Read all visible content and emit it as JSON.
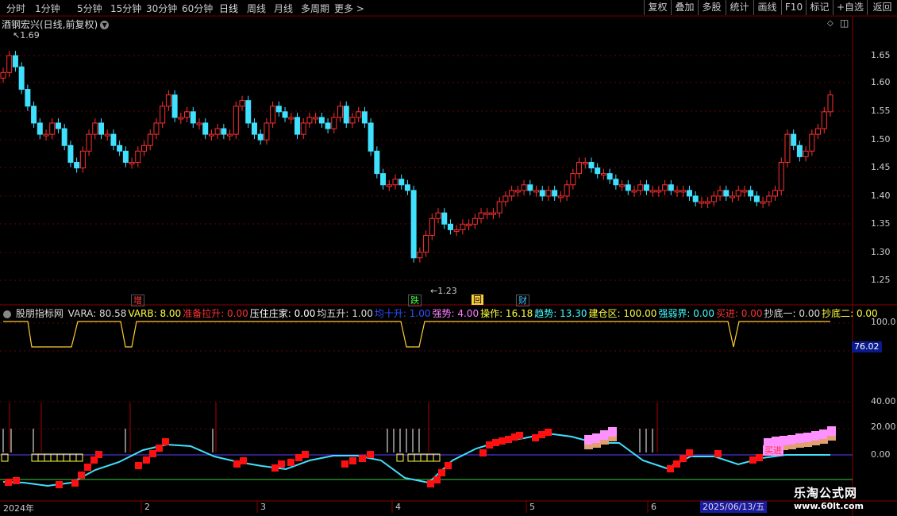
{
  "toolbar": {
    "periods": [
      "分时",
      "1分钟",
      "5分钟",
      "15分钟",
      "30分钟",
      "60分钟",
      "日线",
      "周线",
      "月线",
      "多周期",
      "更多 >"
    ],
    "active_period": "日线",
    "right_buttons": [
      "复权",
      "叠加",
      "多股",
      "统计",
      "画线",
      "F10",
      "标记",
      "+自选",
      "返回"
    ]
  },
  "stock": {
    "title": "酒钢宏兴(日线,前复权)",
    "high_label": "1.69",
    "low_label": "1.23"
  },
  "price_axis": [
    "1.65",
    "1.60",
    "1.55",
    "1.50",
    "1.45",
    "1.40",
    "1.35",
    "1.30",
    "1.25"
  ],
  "markers": [
    {
      "text": "增",
      "color": "#ff4040"
    },
    {
      "text": "跌",
      "color": "#40ff40"
    },
    {
      "text": "回",
      "color": "#ffd040"
    },
    {
      "text": "财",
      "color": "#40c0ff"
    }
  ],
  "indicator": {
    "name": "股朋指标网",
    "items": [
      {
        "label": "VARA: 80.58",
        "color": "#dddddd"
      },
      {
        "label": "VARB: 8.00",
        "color": "#ffff40"
      },
      {
        "label": "准备拉升: 0.00",
        "color": "#ff3030"
      },
      {
        "label": "压住庄家: 0.00",
        "color": "#ffffff"
      },
      {
        "label": "均五升: 1.00",
        "color": "#dddddd"
      },
      {
        "label": "均十升: 1.00",
        "color": "#3050ff"
      },
      {
        "label": "强势: 4.00",
        "color": "#ff80ff"
      },
      {
        "label": "操作: 16.18",
        "color": "#ffff40"
      },
      {
        "label": "趋势: 13.30",
        "color": "#40ffff"
      },
      {
        "label": "建仓区: 100.00",
        "color": "#ffff40"
      },
      {
        "label": "强弱界: 0.00",
        "color": "#40ffff"
      },
      {
        "label": "买进: 0.00",
        "color": "#ff3030"
      },
      {
        "label": "抄底一: 0.00",
        "color": "#dddddd"
      },
      {
        "label": "抄底二: 0.00",
        "color": "#ffff40"
      }
    ],
    "axis": [
      "100.0",
      "40.00",
      "20.00",
      "0.00"
    ],
    "vara_value": "76.02",
    "buy_label": "买进"
  },
  "dates": [
    "2024年",
    "2",
    "3",
    "4",
    "5",
    "6"
  ],
  "current_date": "2025/06/13/五",
  "watermark": {
    "line1": "乐淘公式网",
    "line2": "www.60lt.com"
  },
  "colors": {
    "up": "#ff3030",
    "down": "#40e0ff",
    "grid": "#5a0000",
    "bg": "#000000"
  }
}
